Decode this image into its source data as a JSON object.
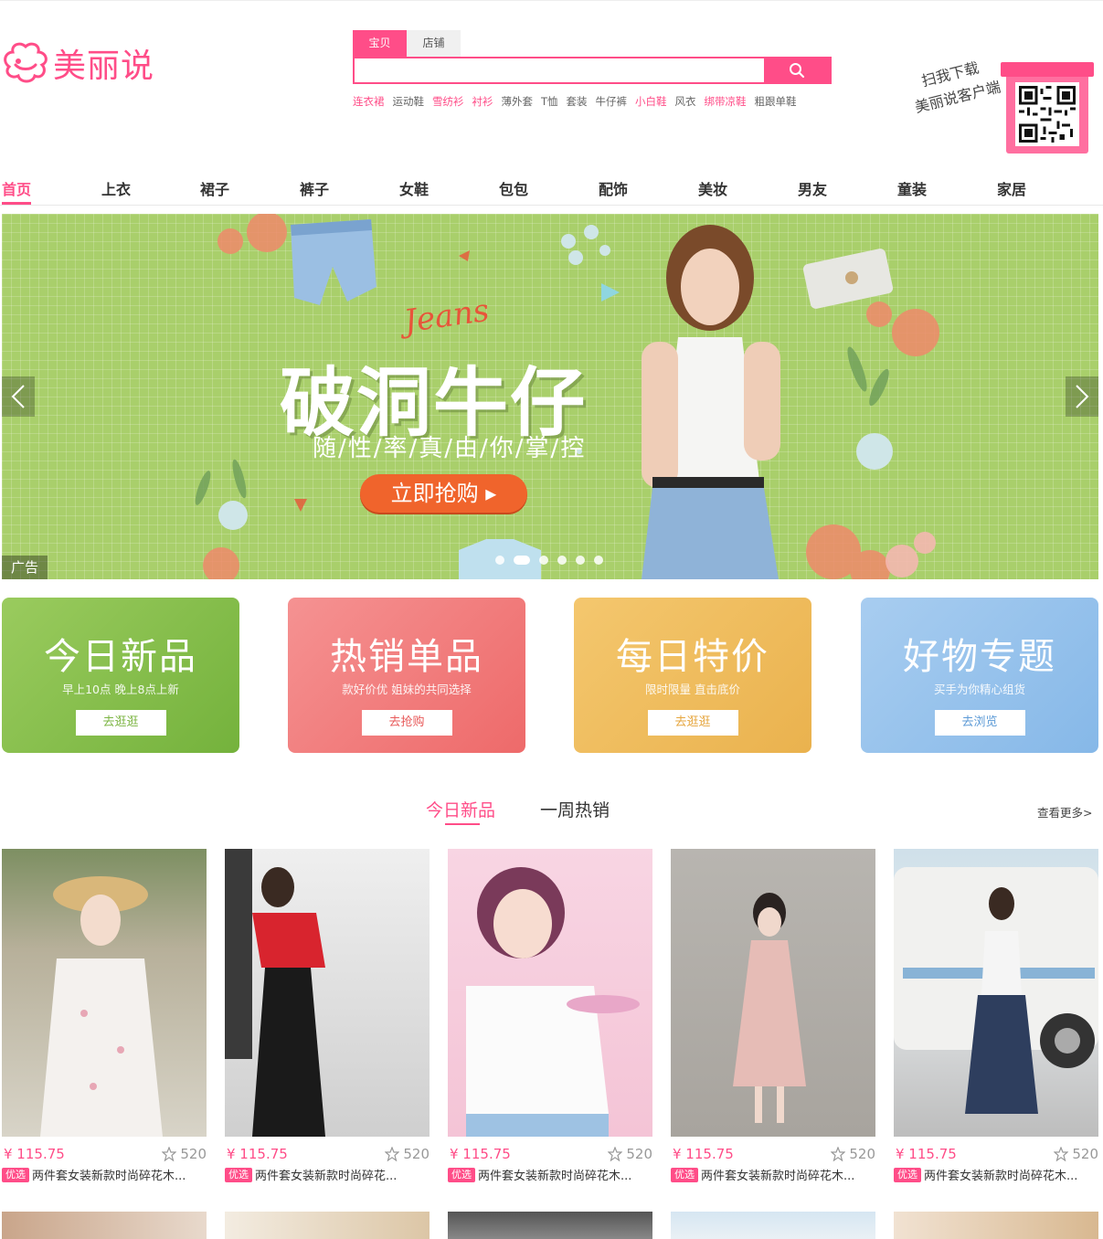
{
  "brand": {
    "name": "美丽说",
    "color": "#ff4d88"
  },
  "search": {
    "tabs": [
      {
        "label": "宝贝",
        "active": true
      },
      {
        "label": "店铺",
        "active": false
      }
    ],
    "placeholder": "",
    "button_icon": "search-icon",
    "hot_words": [
      {
        "label": "连衣裙",
        "highlight": true
      },
      {
        "label": "运动鞋",
        "highlight": false
      },
      {
        "label": "雪纺衫",
        "highlight": true
      },
      {
        "label": "衬衫",
        "highlight": true
      },
      {
        "label": "薄外套",
        "highlight": false
      },
      {
        "label": "T恤",
        "highlight": false
      },
      {
        "label": "套装",
        "highlight": false
      },
      {
        "label": "牛仔裤",
        "highlight": false
      },
      {
        "label": "小白鞋",
        "highlight": true
      },
      {
        "label": "风衣",
        "highlight": false
      },
      {
        "label": "绑带凉鞋",
        "highlight": true
      },
      {
        "label": "粗跟单鞋",
        "highlight": false
      }
    ]
  },
  "app_download": {
    "line1": "扫我下载",
    "line2": "美丽说客户端"
  },
  "nav": {
    "items": [
      {
        "label": "首页",
        "active": true
      },
      {
        "label": "上衣"
      },
      {
        "label": "裙子"
      },
      {
        "label": "裤子"
      },
      {
        "label": "女鞋"
      },
      {
        "label": "包包"
      },
      {
        "label": "配饰"
      },
      {
        "label": "美妆"
      },
      {
        "label": "男友"
      },
      {
        "label": "童装"
      },
      {
        "label": "家居"
      }
    ]
  },
  "banner": {
    "script_text": "Jeans",
    "title": "破洞牛仔",
    "subtitle": "随/性/率/真/由/你/掌/控",
    "cta": "立即抢购 ▸",
    "ad_label": "广告",
    "slide_count": 6,
    "active_slide": 1
  },
  "promos": [
    {
      "title": "今日新品",
      "subtitle": "早上10点 晚上8点上新",
      "button": "去逛逛",
      "color": "#8cc24e",
      "button_color": "#7db544"
    },
    {
      "title": "热销单品",
      "subtitle": "款好价优 姐妹的共同选择",
      "button": "去抢购",
      "color": "#f27a7a",
      "button_color": "#e85a5a"
    },
    {
      "title": "每日特价",
      "subtitle": "限时限量 直击底价",
      "button": "去逛逛",
      "color": "#f2c064",
      "button_color": "#e6a63e"
    },
    {
      "title": "好物专题",
      "subtitle": "买手为你精心组货",
      "button": "去浏览",
      "color": "#9cc6ec",
      "button_color": "#5c9ad6"
    }
  ],
  "section": {
    "tabs": [
      {
        "label": "今日新品",
        "active": true
      },
      {
        "label": "一周热销",
        "active": false
      }
    ],
    "more": "查看更多>"
  },
  "products": [
    {
      "price": "¥ 115.75",
      "likes": "520",
      "badge": "优选",
      "title": "两件套女装新款时尚碎花木..."
    },
    {
      "price": "¥ 115.75",
      "likes": "520",
      "badge": "优选",
      "title": "两件套女装新款时尚碎花..."
    },
    {
      "price": "¥ 115.75",
      "likes": "520",
      "badge": "优选",
      "title": "两件套女装新款时尚碎花木..."
    },
    {
      "price": "¥ 115.75",
      "likes": "520",
      "badge": "优选",
      "title": "两件套女装新款时尚碎花木..."
    },
    {
      "price": "¥ 115.75",
      "likes": "520",
      "badge": "优选",
      "title": "两件套女装新款时尚碎花木..."
    }
  ]
}
